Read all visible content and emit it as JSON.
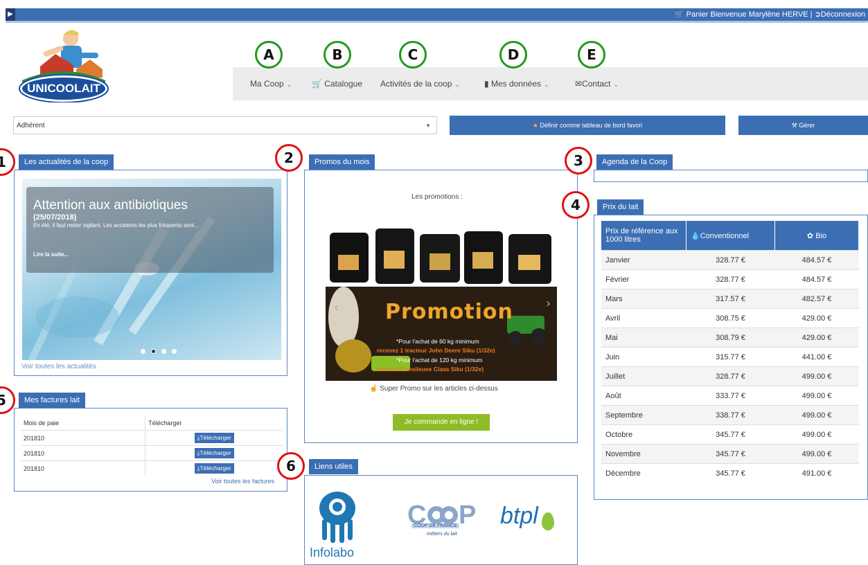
{
  "topbar": {
    "cart": "Panier",
    "welcome": "Bienvenue Marylène HERVE",
    "sep": "|",
    "logout": "Déconnexion"
  },
  "logo": {
    "text": "UNICOOLAIT"
  },
  "nav": {
    "items": [
      {
        "label": "Ma Coop",
        "letter": "A"
      },
      {
        "label": "Catalogue",
        "letter": "B"
      },
      {
        "label": "Activités de la coop",
        "letter": "C"
      },
      {
        "label": "Mes données",
        "letter": "D"
      },
      {
        "label": "Contact",
        "letter": "E"
      }
    ]
  },
  "dashboard": {
    "select_value": "Adhérent",
    "favorite_label": "Définir comme tableau de bord favori",
    "manage_label": "Gérer"
  },
  "markers": [
    "1",
    "2",
    "3",
    "4",
    "5",
    "6"
  ],
  "news": {
    "tab": "Les actualités de la coop",
    "title": "Attention aux antibiotiques",
    "date": "(25/07/2018)",
    "excerpt": "En été, il faut rester vigilant. Les accidents les plus fréquents sont...",
    "read_more": "Lire la suite...",
    "all_link": "Voir toutes les actualités"
  },
  "promos": {
    "tab": "Promos du mois",
    "intro": "Les promotions :",
    "banner_title": "Promotion",
    "line1": "*Pour l'achat de 60 kg minimum",
    "line2": "recevez 1 tracteur John Deere Siku (1/32e)",
    "line3": "*Pour l'achat de 120 kg minimum",
    "line4": "recevez 1 ensileuse Claas Siku (1/32e)",
    "like_text": "Super Promo sur les articles ci-dessus",
    "order_button": "Je commande en ligne !"
  },
  "agenda": {
    "tab": "Agenda de la Coop"
  },
  "milk": {
    "tab": "Prix du lait",
    "headers": [
      "Prix de référence aux 1000 litres",
      "Conventionnel",
      "Bio"
    ],
    "rows": [
      [
        "Janvier",
        "328.77 €",
        "484.57 €"
      ],
      [
        "Février",
        "328.77 €",
        "484.57 €"
      ],
      [
        "Mars",
        "317.57 €",
        "482.57 €"
      ],
      [
        "Avril",
        "308.75 €",
        "429.00 €"
      ],
      [
        "Mai",
        "308.79 €",
        "429.00 €"
      ],
      [
        "Juin",
        "315.77 €",
        "441.00 €"
      ],
      [
        "Juillet",
        "328.77 €",
        "499.00 €"
      ],
      [
        "Août",
        "333.77 €",
        "499.00 €"
      ],
      [
        "Septembre",
        "338.77 €",
        "499.00 €"
      ],
      [
        "Octobre",
        "345.77 €",
        "499.00 €"
      ],
      [
        "Novembre",
        "345.77 €",
        "499.00 €"
      ],
      [
        "Décembre",
        "345.77 €",
        "491.00 €"
      ]
    ]
  },
  "invoices": {
    "tab": "Mes factures lait",
    "headers": [
      "Mois de paie",
      "Télécharger"
    ],
    "rows": [
      {
        "month": "201810",
        "action": "Télécharger"
      },
      {
        "month": "201810",
        "action": "Télécharger"
      },
      {
        "month": "201810",
        "action": "Télécharger"
      }
    ],
    "all_link": "Voir toutes les factures"
  },
  "links": {
    "tab": "Liens utiles",
    "partners": [
      "Infolabo",
      "COOP DE FRANCE",
      "métiers du lait",
      "btpl"
    ]
  }
}
